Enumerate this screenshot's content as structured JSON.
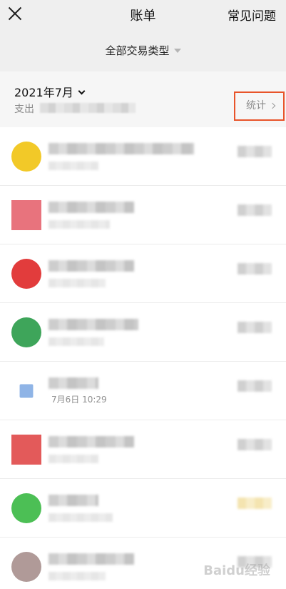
{
  "header": {
    "title": "账单",
    "faq_label": "常见问题",
    "close_icon": "close-icon"
  },
  "filter": {
    "label": "全部交易类型"
  },
  "summary": {
    "month": "2021年7月",
    "spend_label": "支出",
    "stats_label": "统计"
  },
  "transactions": [
    {
      "icon_color": "#f2c928",
      "subtitle": ""
    },
    {
      "icon_color": "#e8737d",
      "subtitle": ""
    },
    {
      "icon_color": "#e23c3c",
      "subtitle": ""
    },
    {
      "icon_color": "#3ea55a",
      "subtitle": ""
    },
    {
      "icon_color": "#8fb4e6",
      "subtitle": "7月6日 10:29"
    },
    {
      "icon_color": "#e35a5a",
      "subtitle": ""
    },
    {
      "icon_color": "#4cbf55",
      "subtitle": ""
    },
    {
      "icon_color": "#b09a98",
      "subtitle": ""
    }
  ],
  "watermark": "Baidu经验"
}
